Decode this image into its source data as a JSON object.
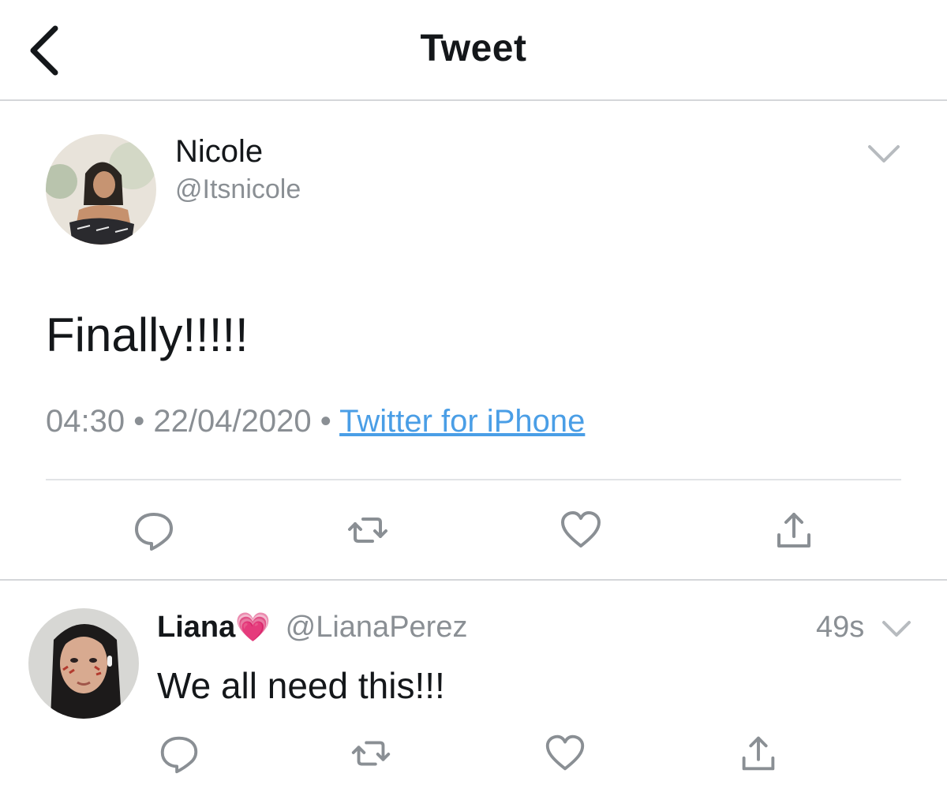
{
  "header": {
    "title": "Tweet"
  },
  "tweet": {
    "author_name": "Nicole",
    "author_handle": "@Itsnicole",
    "text": "Finally!!!!!",
    "time": "04:30",
    "separator": "•",
    "date": "22/04/2020",
    "source": "Twitter for iPhone"
  },
  "reply": {
    "author_name": "Liana",
    "emoji": "💗",
    "author_handle": "@LianaPerez",
    "time_ago": "49s",
    "text": "We all need this!!!"
  },
  "icons": {
    "back": "chevron-left-icon",
    "caret": "chevron-down-icon",
    "reply": "comment-icon",
    "retweet": "retweet-icon",
    "like": "heart-icon",
    "share": "share-icon"
  },
  "colors": {
    "link": "#4a9ee6",
    "secondary_text": "#8a8f94",
    "icon": "#8a8f94",
    "divider": "#e1e3e6"
  }
}
